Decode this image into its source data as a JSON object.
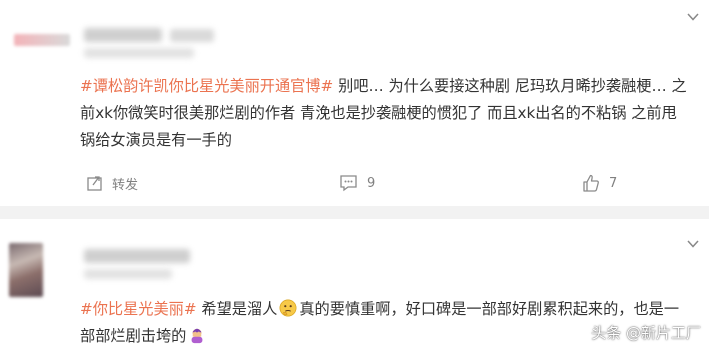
{
  "comments": [
    {
      "hashtag": "#谭松韵许凯你比星光美丽开通官博#",
      "text": " 别吧… 为什么要接这种剧 尼玛玖月晞抄袭融梗… 之前xk你微笑时很美那烂剧的作者 青浼也是抄袭融梗的惯犯了 而且xk出名的不粘锅 之前甩锅给女演员是有一手的",
      "repost_label": "转发",
      "comment_count": "9",
      "like_count": "7"
    },
    {
      "hashtag": "#你比星光美丽#",
      "text_before_emoji": " 希望是溜人",
      "text_after_emoji": "真的要慎重啊，好口碑是一部部好剧累积起来的，也是一部部烂剧击垮的"
    }
  ],
  "watermark": {
    "text": "头条 @新片工厂"
  },
  "colors": {
    "hashtag": "#eb7350",
    "text": "#333333",
    "meta": "#808080",
    "divider": "#f2f2f2"
  },
  "icons": [
    "chevron-down-icon",
    "repost-icon",
    "comment-icon",
    "like-icon",
    "thinking-face-emoji",
    "facepalm-emoji",
    "toutiao-logo"
  ]
}
